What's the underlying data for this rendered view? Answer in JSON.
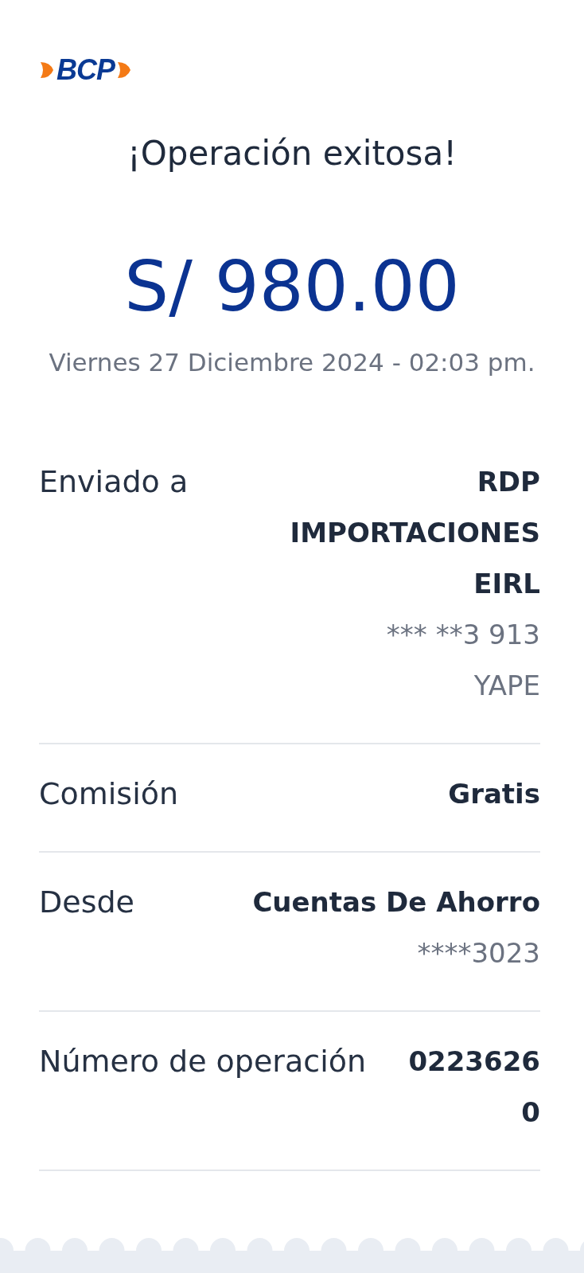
{
  "logo": {
    "text": "BCP"
  },
  "title": "¡Operación exitosa!",
  "amount": "S/ 980.00",
  "datetime": "Viernes 27 Diciembre 2024 - 02:03 pm.",
  "details": [
    {
      "label": "Enviado a",
      "value": "RDP IMPORTACIONES EIRL",
      "extra": [
        "*** **3 913",
        "YAPE"
      ]
    },
    {
      "label": "Comisión",
      "value": "Gratis"
    },
    {
      "label": "Desde",
      "value": "Cuentas De Ahorro",
      "extra": [
        "****3023"
      ]
    },
    {
      "label": "Número de operación",
      "value": "02236260",
      "kind": "code"
    }
  ]
}
